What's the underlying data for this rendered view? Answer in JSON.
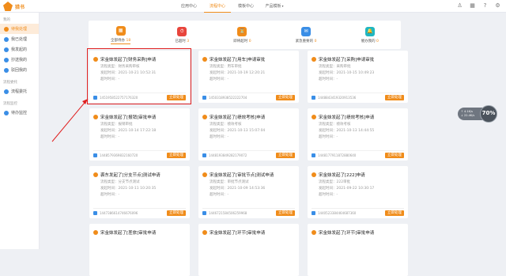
{
  "app": {
    "logo_text": "猎书"
  },
  "nav": [
    {
      "label": "应用中心",
      "caret": false
    },
    {
      "label": "流程中心",
      "caret": false,
      "active": true
    },
    {
      "label": "模板中心",
      "caret": false
    },
    {
      "label": "产品模板",
      "caret": true
    }
  ],
  "topbar_icons": [
    {
      "name": "user-icon",
      "glyph": "♙"
    },
    {
      "name": "grid-icon",
      "glyph": "▦"
    },
    {
      "name": "help-icon",
      "glyph": "?"
    },
    {
      "name": "settings-icon",
      "glyph": "⚙"
    }
  ],
  "sidebar": {
    "sections": [
      {
        "title": "我的",
        "items": [
          {
            "label": "待我处理",
            "active": true
          },
          {
            "label": "我已处理"
          },
          {
            "label": "我发起的"
          },
          {
            "label": "抄送我的"
          },
          {
            "label": "驳回我的"
          }
        ]
      },
      {
        "title": "流程委托",
        "items": [
          {
            "label": "流程委托"
          }
        ]
      },
      {
        "title": "流程监控",
        "items": [
          {
            "label": "待办监控"
          }
        ]
      }
    ]
  },
  "stats": [
    {
      "label": "全部待办",
      "count": "18",
      "color": "#f08c1a",
      "active": true
    },
    {
      "label": "已超时",
      "count": "3",
      "color": "#e8453c"
    },
    {
      "label": "即将超时",
      "count": "0",
      "color": "#f08c1a"
    },
    {
      "label": "紧急重要的",
      "count": "0",
      "color": "#3a8ee6"
    },
    {
      "label": "催办我的",
      "count": "0",
      "color": "#20b6c0"
    }
  ],
  "card_labels": {
    "type": "流程类型：",
    "time": "发起时间：",
    "overdue": "超时时间：",
    "action": "立即处理"
  },
  "cards": [
    {
      "title": "宋金妹发起了[财务采购]申请",
      "type": "财务采购审核",
      "time": "2021-10-21 10:52:31",
      "overdue": "-",
      "id": "1451958522757176320"
    },
    {
      "title": "宋金妹发起了[用车]申请审批",
      "type": "用车审批",
      "time": "2021-10-19 12:20:21",
      "overdue": "-",
      "id": "1450318938522222704"
    },
    {
      "title": "宋金妹发起了[采购]申请审批",
      "type": "采购审批",
      "time": "2021-10-15 10:49:23",
      "overdue": "-",
      "id": "1448843419320913536"
    },
    {
      "title": "宋金妹发起了[报销]审批申请",
      "type": "报销审批",
      "time": "2021-10-14 17:22:18",
      "overdue": "-",
      "id": "1448579369832160720"
    },
    {
      "title": "宋金妹发起了[绩效考核]申请",
      "type": "绩效考核",
      "time": "2021-10-13 15:07:04",
      "overdue": "-",
      "id": "1448193849282179072"
    },
    {
      "title": "宋金妹发起了[绩效考核]申请",
      "type": "绩效考核",
      "time": "2021-10-13 14:44:55",
      "overdue": "-",
      "id": "1448177911872880640"
    },
    {
      "title": "裘东发起了[分支节点]测试申请",
      "type": "分支节点测试",
      "time": "2021-10-11 10:20:35",
      "overdue": "-",
      "id": "1447386614746676096"
    },
    {
      "title": "宋金妹发起了[审批节点]测试申请",
      "type": "审批节点测试",
      "time": "2021-10-09 14:53:36",
      "overdue": "-",
      "id": "1446721584506259968"
    },
    {
      "title": "宋金妹发起了[222]申请",
      "type": "222审批",
      "time": "2021-09-22 10:30:17",
      "overdue": "-",
      "id": "1440523384464687360"
    },
    {
      "title": "宋金妹发起了[差旅]审批申请",
      "type": "",
      "time": "",
      "overdue": "",
      "id": ""
    },
    {
      "title": "宋金妹发起了[环节]审批申请",
      "type": "",
      "time": "",
      "overdue": "",
      "id": ""
    },
    {
      "title": "宋金妹发起了[环节]审批申请",
      "type": "",
      "time": "",
      "overdue": "",
      "id": ""
    }
  ],
  "floating_widget": {
    "line1": "↑ 4.1K/s",
    "line2": "↓ 22.4K/s",
    "percent": "70%"
  }
}
